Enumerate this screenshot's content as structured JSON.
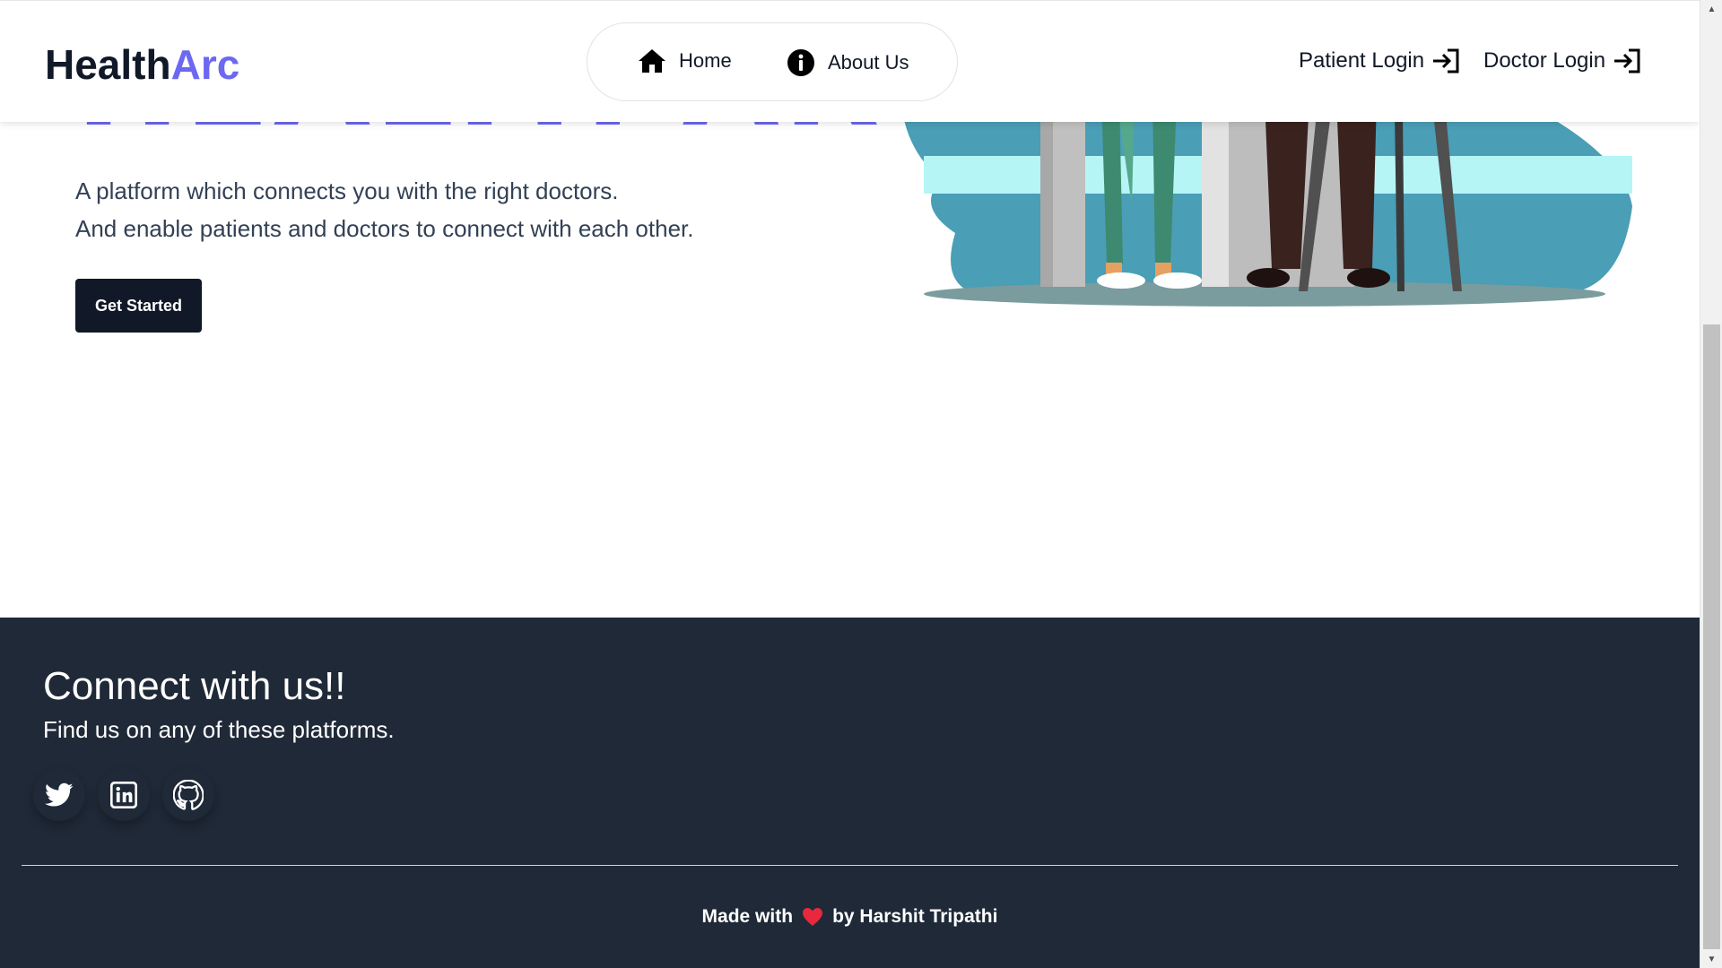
{
  "header": {
    "brand_part1": "Health",
    "brand_part2": "Arc",
    "brand_color": "#6c68f0",
    "nav": [
      {
        "label": "Home",
        "icon": "home-icon"
      },
      {
        "label": "About Us",
        "icon": "info-icon"
      }
    ],
    "logins": [
      {
        "label": "Patient Login",
        "icon": "login-icon"
      },
      {
        "label": "Doctor Login",
        "icon": "login-icon"
      }
    ]
  },
  "hero": {
    "title": "HEALTH ARC",
    "line1": "A platform which connects you with the right doctors.",
    "line2": "And enable patients and doctors to connect with each other.",
    "cta_label": "Get Started"
  },
  "footer": {
    "title": "Connect with us!!",
    "subtitle": "Find us on any of these platforms.",
    "socials": [
      "twitter-icon",
      "linkedin-icon",
      "github-icon"
    ],
    "credit_prefix": "Made with",
    "credit_suffix": "by Harshit Tripathi",
    "background_color": "#1f2937"
  }
}
